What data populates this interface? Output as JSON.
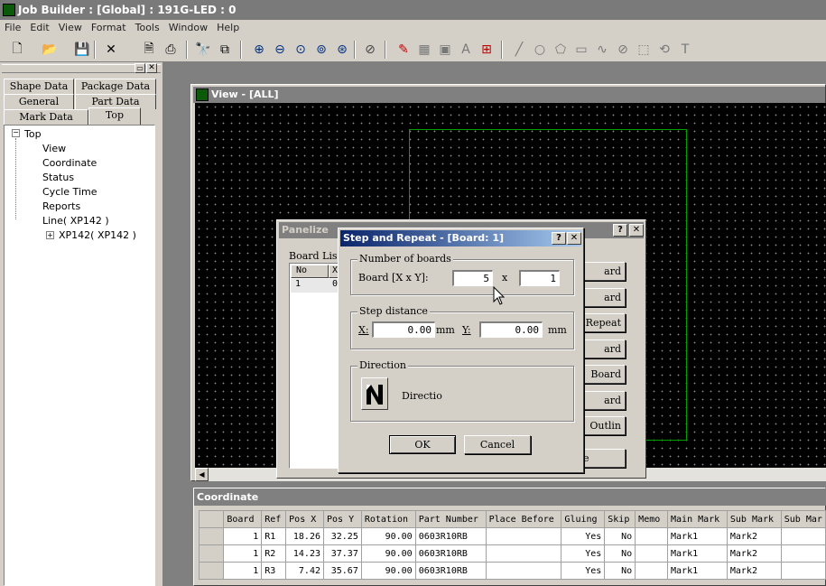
{
  "app": {
    "title": "Job Builder : [Global] : 191G-LED : 0"
  },
  "menu": [
    "File",
    "Edit",
    "View",
    "Format",
    "Tools",
    "Window",
    "Help"
  ],
  "left_tabs": {
    "shape_data": "Shape Data",
    "package_data": "Package Data",
    "general": "General",
    "part_data": "Part Data",
    "mark_data": "Mark Data",
    "top": "Top"
  },
  "tree": {
    "root": "Top",
    "items": [
      "View",
      "Coordinate",
      "Status",
      "Cycle Time",
      "Reports"
    ],
    "line": "Line( XP142 )",
    "child": "XP142( XP142 )"
  },
  "view_window": {
    "title": "View - [ALL]"
  },
  "panelize": {
    "title": "Panelize",
    "board_list_label": "Board Lis",
    "col_no": "No",
    "col_x": "X",
    "row_no": "1",
    "row_x": "0",
    "buttons": [
      "ard",
      "ard",
      "Repeat",
      "ard",
      "Board",
      "ard",
      "Outlin",
      "e"
    ]
  },
  "step_dialog": {
    "title": "Step and Repeat - [Board: 1]",
    "help": "?",
    "close": "✕",
    "num_boards_group": "Number of boards",
    "board_label": "Board [X x Y]:",
    "board_x": "5",
    "x_sep": "x",
    "board_y": "1",
    "step_group": "Step distance",
    "x_label": "X:",
    "x_value": "0.00",
    "x_unit": "mm",
    "y_label": "Y:",
    "y_value": "0.00",
    "y_unit": "mm",
    "direction_group": "Direction",
    "direction_text": "Directio",
    "ok": "OK",
    "cancel": "Cancel"
  },
  "coordinate": {
    "title": "Coordinate",
    "columns": [
      "Board",
      "Ref",
      "Pos X",
      "Pos Y",
      "Rotation",
      "Part Number",
      "Place Before",
      "Gluing",
      "Skip",
      "Memo",
      "Main Mark",
      "Sub Mark",
      "Sub Mar"
    ],
    "rows": [
      [
        "1",
        "R1",
        "18.26",
        "32.25",
        "90.00",
        "0603R10RB",
        "",
        "Yes",
        "No",
        "",
        "Mark1",
        "Mark2",
        ""
      ],
      [
        "1",
        "R2",
        "14.23",
        "37.37",
        "90.00",
        "0603R10RB",
        "",
        "Yes",
        "No",
        "",
        "Mark1",
        "Mark2",
        ""
      ],
      [
        "1",
        "R3",
        "7.42",
        "35.67",
        "90.00",
        "0603R10RB",
        "",
        "Yes",
        "No",
        "",
        "Mark1",
        "Mark2",
        ""
      ]
    ]
  }
}
